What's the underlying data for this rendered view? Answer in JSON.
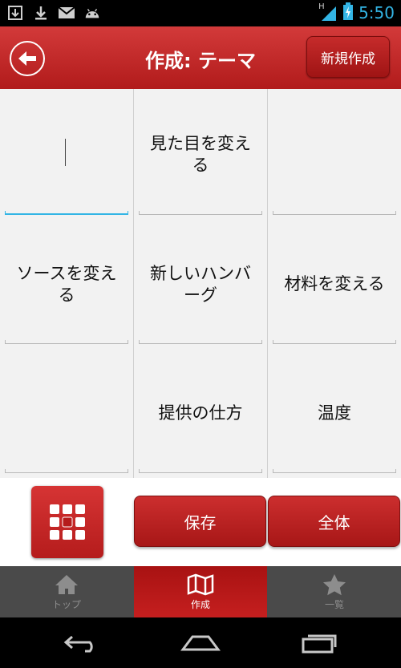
{
  "status_bar": {
    "time": "5:50",
    "icons": [
      "download-box-icon",
      "download-icon",
      "gmail-icon",
      "android-icon",
      "signal-icon",
      "battery-charging-icon"
    ],
    "network_letter": "H"
  },
  "action_bar": {
    "title": "作成: テーマ",
    "new_button": "新規作成"
  },
  "grid": {
    "cells": [
      {
        "label": "",
        "focused": true
      },
      {
        "label": "見た目を変える"
      },
      {
        "label": ""
      },
      {
        "label": "ソースを変える"
      },
      {
        "label": "新しいハンバーグ"
      },
      {
        "label": "材料を変える"
      },
      {
        "label": ""
      },
      {
        "label": "提供の仕方"
      },
      {
        "label": "温度"
      }
    ]
  },
  "buttons": {
    "save": "保存",
    "all": "全体"
  },
  "tabs": [
    {
      "label": "トップ",
      "icon": "home-icon",
      "active": false
    },
    {
      "label": "作成",
      "icon": "map-icon",
      "active": true
    },
    {
      "label": "一覧",
      "icon": "star-icon",
      "active": false
    }
  ],
  "colors": {
    "accent_red": "#c62828",
    "focus_blue": "#33b5e5",
    "status_blue": "#33b5e5"
  }
}
